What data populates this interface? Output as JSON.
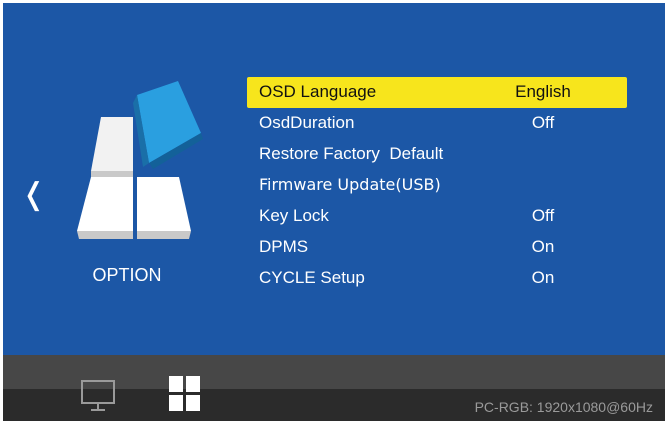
{
  "osd": {
    "back_glyph": "❬",
    "section_label": "OPTION",
    "menu": [
      {
        "label": "OSD Language",
        "value": "English",
        "selected": true
      },
      {
        "label": "OsdDuration",
        "value": "Off"
      },
      {
        "label": "Restore Factory  Default",
        "value": ""
      },
      {
        "label": "Firmware Update(USB)",
        "value": ""
      },
      {
        "label": "Key Lock",
        "value": "Off"
      },
      {
        "label": "DPMS",
        "value": "On"
      },
      {
        "label": "CYCLE Setup",
        "value": "On"
      }
    ],
    "footer": {
      "monitor_icon": "monitor-icon",
      "option_icon": "grid-icon",
      "signal": "PC-RGB: 1920x1080@60Hz"
    },
    "colors": {
      "background": "#1c57a6",
      "highlight": "#f7e51c",
      "footer_top": "#474747",
      "footer_bottom": "#2b2b2b",
      "cube_accent": "#2a9fe0"
    }
  }
}
